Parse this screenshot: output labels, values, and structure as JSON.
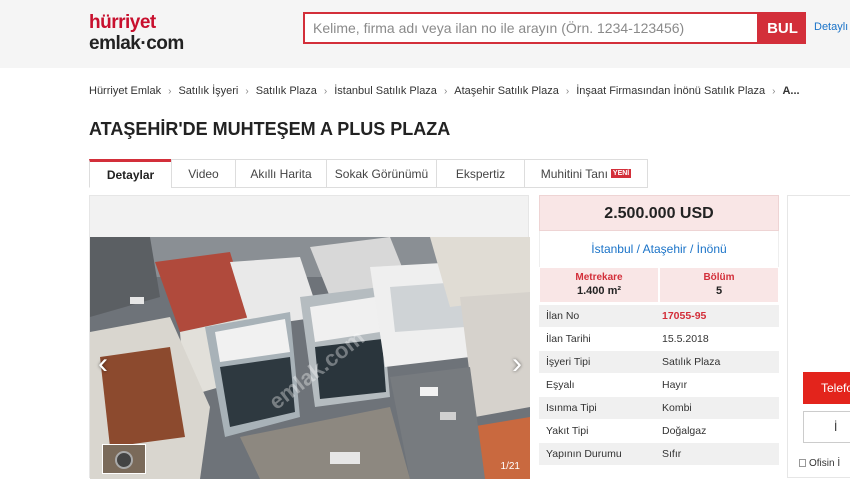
{
  "header": {
    "logo_line1": "hürriyet",
    "logo_line2": "emlak·com",
    "search_placeholder": "Kelime, firma adı veya ilan no ile arayın (Örn. 1234-123456)",
    "search_button": "BUL",
    "detail_link": "Detaylı A"
  },
  "breadcrumb": [
    "Hürriyet Emlak",
    "Satılık İşyeri",
    "Satılık Plaza",
    "İstanbul Satılık Plaza",
    "Ataşehir Satılık Plaza",
    "İnşaat Firmasından İnönü Satılık Plaza",
    "A..."
  ],
  "title": "ATAŞEHİR'DE MUHTEŞEM A PLUS PLAZA",
  "tabs": [
    "Detaylar",
    "Video",
    "Akıllı Harita",
    "Sokak Görünümü",
    "Ekspertiz",
    "Muhitini Tanı"
  ],
  "tab_new_badge": "YENİ",
  "photo": {
    "watermark": "emlak.com",
    "counter": "1/21"
  },
  "info": {
    "price": "2.500.000 USD",
    "location": "İstanbul / Ataşehir / İnönü",
    "area_label": "Metrekare",
    "area_value": "1.400 m²",
    "section_label": "Bölüm",
    "section_value": "5",
    "rows": [
      {
        "k": "İlan No",
        "v": "17055-95"
      },
      {
        "k": "İlan Tarihi",
        "v": "15.5.2018"
      },
      {
        "k": "İşyeri Tipi",
        "v": "Satılık Plaza"
      },
      {
        "k": "Eşyalı",
        "v": "Hayır"
      },
      {
        "k": "Isınma Tipi",
        "v": "Kombi"
      },
      {
        "k": "Yakıt Tipi",
        "v": "Doğalgaz"
      },
      {
        "k": "Yapının Durumu",
        "v": "Sıfır"
      }
    ]
  },
  "sidebar": {
    "phone_button": "Telefo",
    "message_button": "İ",
    "office_label": "Ofisin İ"
  },
  "colors": {
    "brand_red": "#d32f3a",
    "link_blue": "#1a73c8"
  }
}
